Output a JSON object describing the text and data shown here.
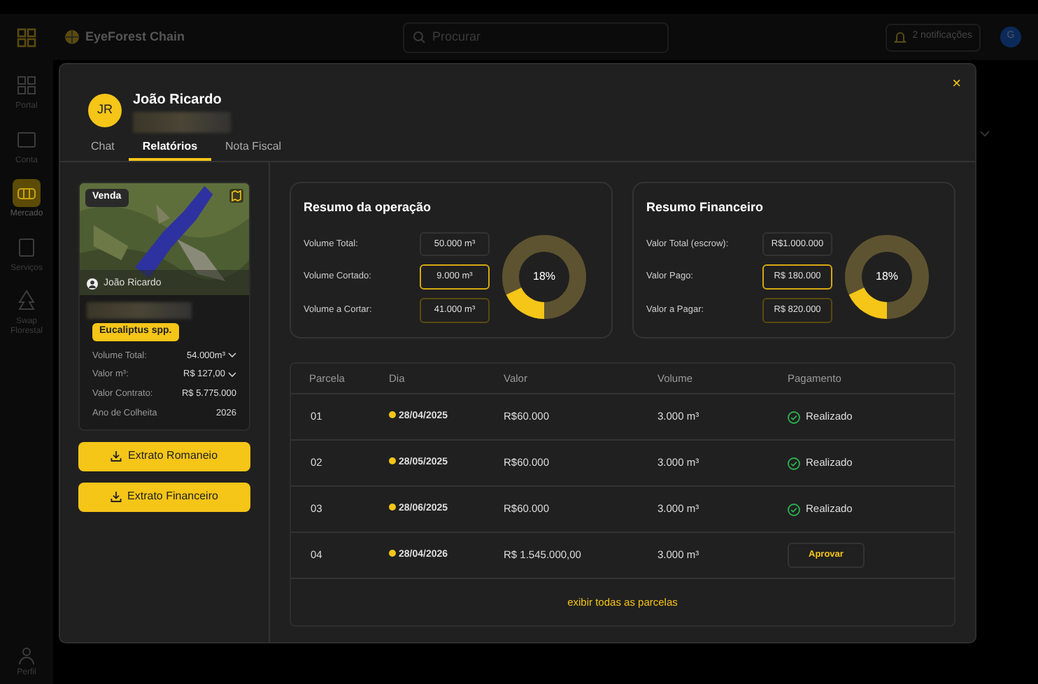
{
  "app": {
    "logo": "EyeForest Chain",
    "search": {
      "placeholder": "Procurar"
    },
    "notifications": "2 notificações",
    "user_initial": "G",
    "sidebar": [
      {
        "label": "Portal",
        "selected": false
      },
      {
        "label": "Conta",
        "selected": false
      },
      {
        "label": "Mercado",
        "selected": true
      },
      {
        "label": "Serviços",
        "selected": false
      },
      {
        "label": "Swap Florestal",
        "selected": false
      }
    ],
    "profile": "Perfil"
  },
  "modal": {
    "initials": "JR",
    "name": "João Ricardo",
    "close": "×",
    "tabs": [
      {
        "label": "Chat",
        "selected": false
      },
      {
        "label": "Relatórios",
        "selected": true
      },
      {
        "label": "Nota Fiscal",
        "selected": false
      }
    ],
    "listing": {
      "badge": "Venda",
      "owner": "João Ricardo",
      "species": "Eucaliptus spp.",
      "rows": [
        {
          "label": "Volume Total:",
          "value": "54.000m³",
          "dropdown": true
        },
        {
          "label": "Valor m³:",
          "value": "R$ 127,00",
          "dropdown": true
        },
        {
          "label": "Valor Contrato:",
          "value": "R$ 5.775.000",
          "dropdown": false
        },
        {
          "label": "Ano de Colheita",
          "value": "2026",
          "dropdown": false
        }
      ]
    },
    "buttons": [
      "Extrato Romaneio",
      "Extrato Financeiro"
    ],
    "summaries": [
      {
        "title": "Resumo da operação",
        "level": 0.18,
        "reading": "18%",
        "fields": [
          {
            "label": "Volume Total:",
            "value": "50.000 m³",
            "kind": "plain"
          },
          {
            "label": "Volume Cortado:",
            "value": "9.000 m³",
            "kind": "strong"
          },
          {
            "label": "Volume a Cortar:",
            "value": "41.000 m³",
            "kind": "dim"
          }
        ]
      },
      {
        "title": "Resumo Financeiro",
        "level": 0.18,
        "reading": "18%",
        "fields": [
          {
            "label": "Valor Total (escrow):",
            "value": "R$1.000.000",
            "kind": "plain"
          },
          {
            "label": "Valor Pago:",
            "value": "R$ 180.000",
            "kind": "strong"
          },
          {
            "label": "Valor a Pagar:",
            "value": "R$ 820.000",
            "kind": "dim"
          }
        ]
      }
    ],
    "table": {
      "columns": [
        "Parcela",
        "Dia",
        "Valor",
        "Volume",
        "Pagamento"
      ],
      "rows": [
        {
          "parcela": "01",
          "dia": "28/04/2025",
          "valor": "R$60.000",
          "volume": "3.000 m³",
          "payment": {
            "kind": "done",
            "label": "Realizado"
          }
        },
        {
          "parcela": "02",
          "dia": "28/05/2025",
          "valor": "R$60.000",
          "volume": "3.000 m³",
          "payment": {
            "kind": "done",
            "label": "Realizado"
          }
        },
        {
          "parcela": "03",
          "dia": "28/06/2025",
          "valor": "R$60.000",
          "volume": "3.000 m³",
          "payment": {
            "kind": "done",
            "label": "Realizado"
          }
        },
        {
          "parcela": "04",
          "dia": "28/04/2026",
          "valor": "R$ 1.545.000,00",
          "volume": "3.000 m³",
          "payment": {
            "kind": "button",
            "label": "Aprovar"
          }
        }
      ],
      "footer_link": "exibir todas as parcelas"
    }
  }
}
